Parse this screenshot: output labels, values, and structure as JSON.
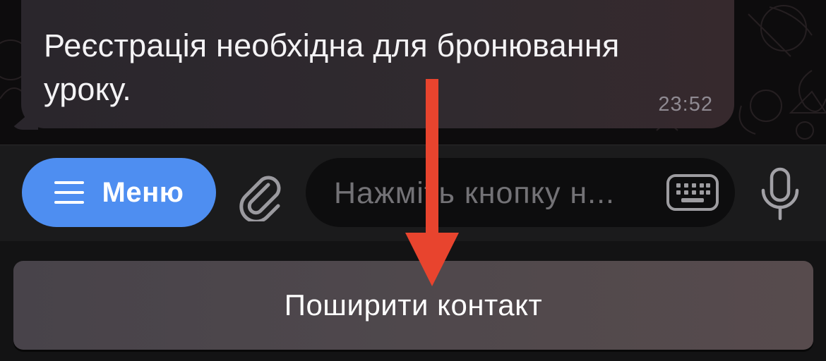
{
  "chat": {
    "message_text": "Реєстрація необхідна для бронювання уроку.",
    "message_time": "23:52"
  },
  "input_bar": {
    "menu_label": "Меню",
    "placeholder": "Нажміть кнопку н..."
  },
  "reply_keyboard": {
    "share_contact_label": "Поширити контакт"
  },
  "colors": {
    "accent": "#4e8ef1",
    "arrow": "#e8442e",
    "bubble": "#2e2a2e"
  },
  "icons": {
    "menu": "hamburger-icon",
    "attach": "paperclip-icon",
    "keyboard": "keyboard-icon",
    "mic": "microphone-icon"
  }
}
